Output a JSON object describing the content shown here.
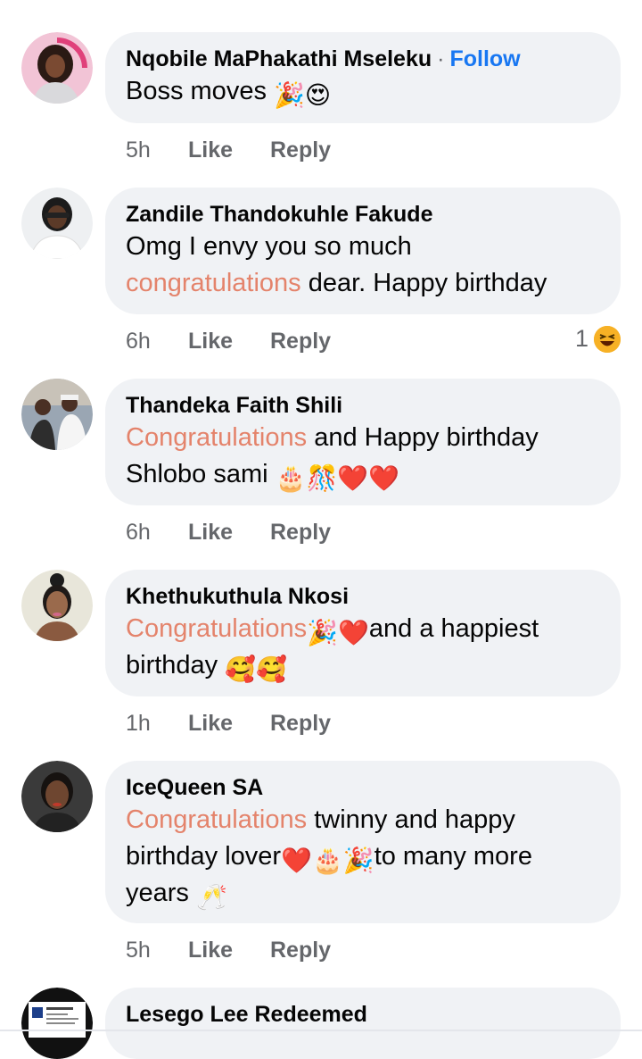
{
  "comments": [
    {
      "author": "Nqobile MaPhakathi Mseleku",
      "follow_label": "Follow",
      "separator": "·",
      "text_1": "Boss moves ",
      "emojis_1": "🎉😍",
      "time": "5h",
      "like": "Like",
      "reply": "Reply"
    },
    {
      "author": "Zandile Thandokuhle Fakude",
      "text_1": "Omg I envy you so much",
      "highlight": "congratulations",
      "text_2": " dear. Happy birthday",
      "time": "6h",
      "like": "Like",
      "reply": "Reply",
      "reaction_count": "1",
      "reaction_icon": "laugh-icon"
    },
    {
      "author": "Thandeka Faith Shili",
      "highlight": "Congratulations",
      "text_1": " and Happy birthday",
      "text_2": "Shlobo sami ",
      "emojis_2": "🎂🎊❤️❤️",
      "time": "6h",
      "like": "Like",
      "reply": "Reply"
    },
    {
      "author": "Khethukuthula Nkosi",
      "highlight": "Congratulations",
      "emojis_1": " 🎉❤️",
      "text_1": "and a happiest",
      "text_2": "birthday ",
      "emojis_2": "🥰🥰",
      "time": "1h",
      "like": "Like",
      "reply": "Reply"
    },
    {
      "author": "IceQueen SA",
      "highlight": "Congratulations",
      "text_1": " twinny and happy",
      "text_2": "birthday lover",
      "emojis_2": "❤️🎂🎉",
      "text_3": "to many more",
      "text_4": "years ",
      "emojis_4": "🥂",
      "time": "5h",
      "like": "Like",
      "reply": "Reply"
    },
    {
      "author": "Lesego Lee Redeemed"
    }
  ],
  "colors": {
    "bubble_bg": "#f0f2f5",
    "follow_blue": "#1877f2",
    "highlight_orange": "#e4836b",
    "meta_gray": "#65676b"
  }
}
